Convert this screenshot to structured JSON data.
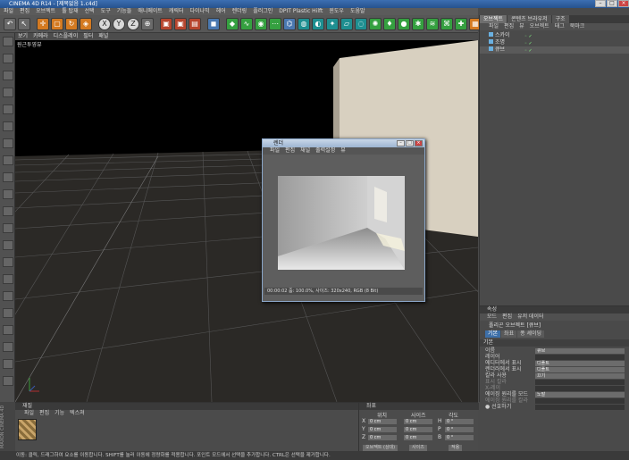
{
  "window": {
    "title": "CINEMA 4D  R14  - [제목없음 1.c4d]",
    "buttons": [
      "–",
      "□",
      "×"
    ]
  },
  "menubar": [
    "파일",
    "편집",
    "오브젝트",
    "툴 탑재",
    "선택",
    "도구",
    "기능들",
    "애니메이트",
    "캐릭터",
    "다이나믹",
    "헤어",
    "렌더링",
    "플러그인",
    "DPIT Plastic Hilft",
    "윈도우",
    "도움말"
  ],
  "toolbar": {
    "tools": [
      {
        "icon": "undo-icon",
        "glyph": "↶",
        "tone": "grey"
      },
      {
        "icon": "select-icon",
        "glyph": "↖",
        "tone": "grey"
      },
      {
        "icon": "move-icon",
        "glyph": "✛",
        "tone": "orange"
      },
      {
        "icon": "scale-icon",
        "glyph": "▢",
        "tone": "orange"
      },
      {
        "icon": "rotate-icon",
        "glyph": "↻",
        "tone": "orange"
      },
      {
        "icon": "model-icon",
        "glyph": "◈",
        "tone": "orange"
      },
      {
        "icon": "x-axis-icon",
        "glyph": "X",
        "tone": "axis"
      },
      {
        "icon": "y-axis-icon",
        "glyph": "Y",
        "tone": "axis"
      },
      {
        "icon": "z-axis-icon",
        "glyph": "Z",
        "tone": "axis"
      },
      {
        "icon": "world-coord-icon",
        "glyph": "⊕",
        "tone": "grey"
      },
      {
        "icon": "render-view-icon",
        "glyph": "▣",
        "tone": "red"
      },
      {
        "icon": "render-picture-viewer-icon",
        "glyph": "▣",
        "tone": "red"
      },
      {
        "icon": "render-settings-icon",
        "glyph": "▤",
        "tone": "red"
      },
      {
        "icon": "cube-icon",
        "glyph": "◼",
        "tone": "blue"
      },
      {
        "icon": "subdivision-icon",
        "glyph": "◆",
        "tone": "green"
      },
      {
        "icon": "spline-icon",
        "glyph": "∿",
        "tone": "green"
      },
      {
        "icon": "nurbs-icon",
        "glyph": "◉",
        "tone": "green"
      },
      {
        "icon": "array-icon",
        "glyph": "⋯",
        "tone": "green"
      },
      {
        "icon": "deformer-icon",
        "glyph": "⌬",
        "tone": "blue"
      },
      {
        "icon": "scene-icon",
        "glyph": "◍",
        "tone": "teal"
      },
      {
        "icon": "camera-icon",
        "glyph": "◐",
        "tone": "teal"
      },
      {
        "icon": "light-icon",
        "glyph": "✦",
        "tone": "teal"
      },
      {
        "icon": "floor-icon",
        "glyph": "▱",
        "tone": "teal"
      },
      {
        "icon": "sky-icon",
        "glyph": "◌",
        "tone": "teal"
      },
      {
        "icon": "environment-icon",
        "glyph": "✺",
        "tone": "green"
      },
      {
        "icon": "tag-icon",
        "glyph": "♦",
        "tone": "green"
      },
      {
        "icon": "bulb-icon",
        "glyph": "●",
        "tone": "green"
      },
      {
        "icon": "particle-icon",
        "glyph": "✱",
        "tone": "green"
      },
      {
        "icon": "hair-icon",
        "glyph": "≋",
        "tone": "green"
      },
      {
        "icon": "python-icon",
        "glyph": "⌘",
        "tone": "green"
      },
      {
        "icon": "plugin-icon",
        "glyph": "✚",
        "tone": "green"
      },
      {
        "icon": "layout-icon",
        "glyph": "▦",
        "tone": "orange"
      }
    ]
  },
  "left_toolbar": {
    "tools": [
      "make-editable-icon",
      "axis-icon",
      "texture-icon",
      "workplane-icon",
      "points-mode-icon",
      "edges-mode-icon",
      "polygons-mode-icon",
      "object-mode-icon",
      "soft-select-icon",
      "snap-icon",
      "lock-icon",
      "brush-icon",
      "magnet-icon",
      "knife-icon",
      "bridge-icon",
      "extrude-icon",
      "bevel-icon",
      "weld-icon",
      "mirror-icon",
      "grid-icon",
      "sculpt-icon"
    ]
  },
  "viewport": {
    "menu": [
      "보기",
      "카메라",
      "디스플레이",
      "필터",
      "패널"
    ],
    "label": "원근투영뷰"
  },
  "render_window": {
    "title": "렌더",
    "menu": [
      "파일",
      "편집",
      "채널",
      "출력설정",
      "뷰"
    ],
    "status": "00:00:02   줌: 100.0%,  사이즈: 320x240, RGB (8 Bit)"
  },
  "object_manager": {
    "tabs": [
      "오브젝트",
      "콘텐츠 브라우저",
      "구조"
    ],
    "menu": [
      "파일",
      "편집",
      "뷰",
      "오브젝트",
      "태그",
      "북마크"
    ],
    "objects": [
      {
        "name": "스카이",
        "selected": false
      },
      {
        "name": "조명",
        "selected": false
      },
      {
        "name": "큐브",
        "selected": true
      }
    ]
  },
  "attributes": {
    "header": "속성",
    "menu": [
      "모드",
      "편집",
      "유저 데이터"
    ],
    "title": "폴리곤 오브젝트 [큐브]",
    "tabs": [
      "기본",
      "좌표",
      "퐁 셰이딩"
    ],
    "section": "기본",
    "rows": [
      {
        "label": "이름",
        "value": "큐브",
        "dark": false,
        "dim": false
      },
      {
        "label": "레이어",
        "value": "",
        "dark": true,
        "dim": false
      },
      {
        "label": "에디터에서 표시",
        "value": "디폴트",
        "dark": false,
        "dim": false
      },
      {
        "label": "렌더러에서 표시",
        "value": "디폴트",
        "dark": false,
        "dim": false
      },
      {
        "label": "칼라 사용",
        "value": "끄기",
        "dark": false,
        "dim": false
      },
      {
        "label": "표시 칼라",
        "value": "",
        "dark": true,
        "dim": true
      },
      {
        "label": "X-레이",
        "value": "",
        "dark": true,
        "dim": true
      },
      {
        "label": "에이징 원리를 모드",
        "value": "노말",
        "dark": false,
        "dim": false
      },
      {
        "label": "에이징 원리를 칼라",
        "value": "",
        "dark": true,
        "dim": true
      },
      {
        "label": "● 선호하기",
        "value": "",
        "dark": true,
        "dim": false
      }
    ]
  },
  "material_manager": {
    "header": "재질",
    "menu": [
      "파일",
      "편집",
      "기능",
      "텍스쳐"
    ]
  },
  "coordinates": {
    "header": "좌표",
    "columns": [
      "위치",
      "사이즈",
      "각도"
    ],
    "rows": [
      {
        "axis": "X",
        "pos": "0 cm",
        "size": "0 cm",
        "angle_axis": "H",
        "angle": "0 °"
      },
      {
        "axis": "Y",
        "pos": "0 cm",
        "size": "0 cm",
        "angle_axis": "P",
        "angle": "0 °"
      },
      {
        "axis": "Z",
        "pos": "0 cm",
        "size": "0 cm",
        "angle_axis": "B",
        "angle": "0 °"
      }
    ],
    "mode": "오브젝트 (상대)",
    "size_mode": "사이즈",
    "apply": "적용"
  },
  "statusbar": {
    "text": "이동: 클릭, 드래그하여 요소를 이동합니다. SHIFT를 눌러 이동에 정량화를 적용합니다. 포인트 모드에서 선택을 추가합니다. CTRL은 선택을 제거합니다."
  },
  "brand": "MAXON CINEMA 4D",
  "colors": {
    "background": "#4a4a4a",
    "viewport": "#000000",
    "accent_orange": "#d47a21",
    "selection_blue": "#3d6fa8",
    "wall": "#d8d0c0"
  }
}
